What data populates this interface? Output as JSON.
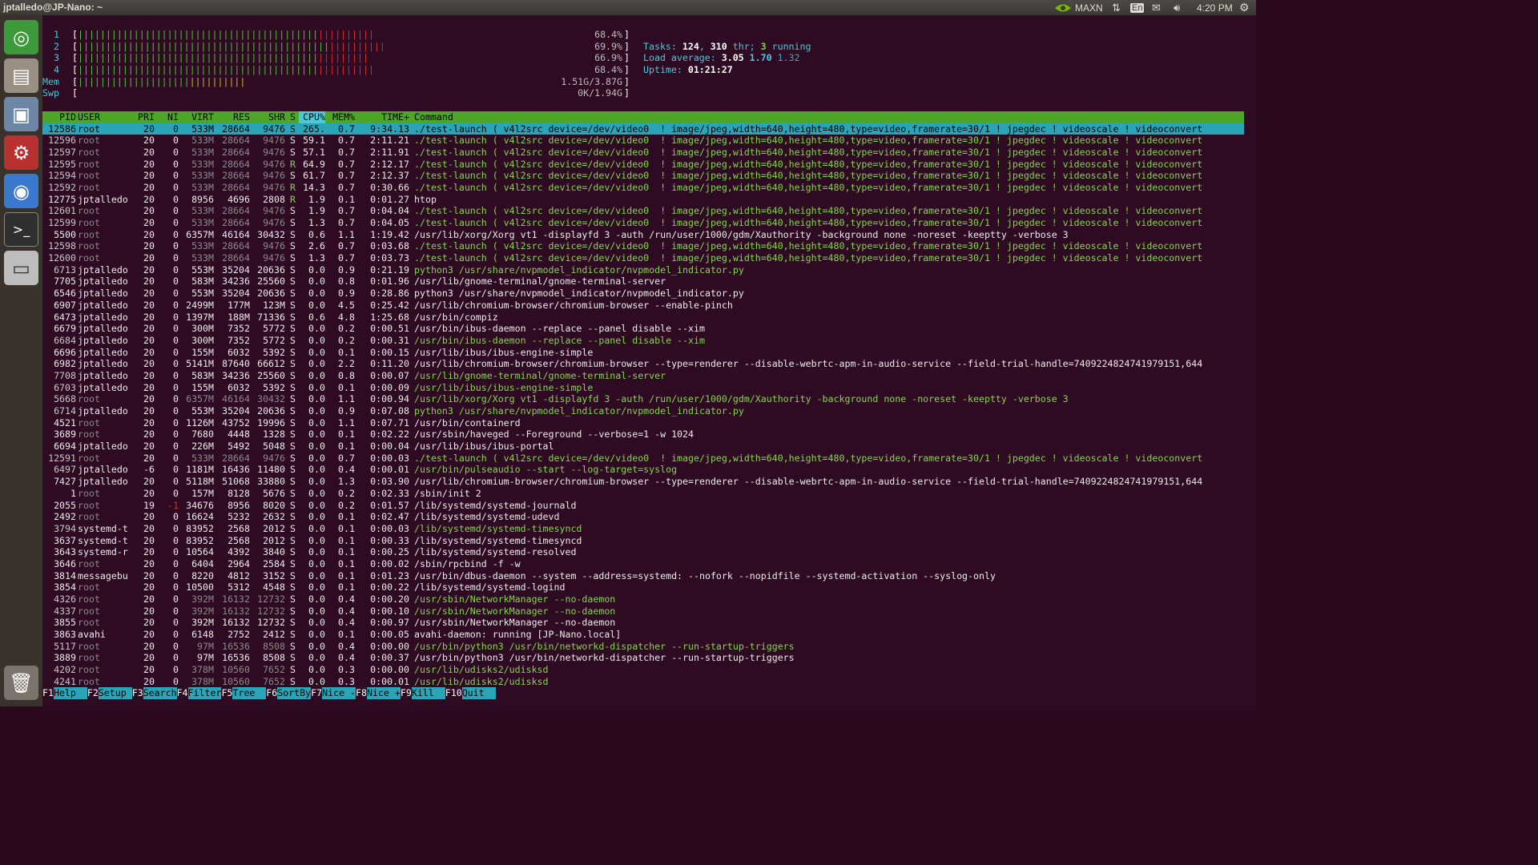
{
  "topbar": {
    "title": "jptalledo@JP-Nano: ~",
    "power_mode": "MAXN",
    "keyboard": "En",
    "clock": "4:20 PM"
  },
  "meters": {
    "cpus": [
      {
        "label": "1",
        "value": "68.4%"
      },
      {
        "label": "2",
        "value": "69.9%"
      },
      {
        "label": "3",
        "value": "66.9%"
      },
      {
        "label": "4",
        "value": "68.4%"
      }
    ],
    "mem": {
      "label": "Mem",
      "value": "1.51G/3.87G"
    },
    "swp": {
      "label": "Swp",
      "value": "0K/1.94G"
    }
  },
  "summary": {
    "tasks_label": "Tasks: ",
    "tasks": "124",
    "thr_sep": ", ",
    "thr": "310",
    "thr_label": " thr; ",
    "running": "3",
    "running_label": " running",
    "load_label": "Load average: ",
    "load1": "3.05",
    "load5": "1.70",
    "load15": "1.32",
    "uptime_label": "Uptime: ",
    "uptime": "01:21:27"
  },
  "header": {
    "pid": "PID",
    "user": "USER",
    "pri": "PRI",
    "ni": "NI",
    "virt": "VIRT",
    "res": "RES",
    "shr": "SHR",
    "s": "S",
    "cpu": "CPU%",
    "mem": "MEM%",
    "time": "TIME+",
    "command": "Command"
  },
  "processes": [
    {
      "pid": "12586",
      "user": "root",
      "pri": "20",
      "ni": "0",
      "virt": "533M",
      "res": "28664",
      "shr": "9476",
      "s": "S",
      "cpu": "265.",
      "mem": "0.7",
      "time": "9:34.13",
      "command": "./test-launch ( v4l2src device=/dev/video0  ! image/jpeg,width=640,height=480,type=video,framerate=30/1 ! jpegdec ! videoscale ! videoconvert",
      "sel": true
    },
    {
      "pid": "12596",
      "user": "root",
      "pri": "20",
      "ni": "0",
      "virt": "533M",
      "res": "28664",
      "shr": "9476",
      "s": "S",
      "cpu": "59.1",
      "mem": "0.7",
      "time": "2:11.21",
      "command": "./test-launch ( v4l2src device=/dev/video0  ! image/jpeg,width=640,height=480,type=video,framerate=30/1 ! jpegdec ! videoscale ! videoconvert",
      "thread": true
    },
    {
      "pid": "12597",
      "user": "root",
      "pri": "20",
      "ni": "0",
      "virt": "533M",
      "res": "28664",
      "shr": "9476",
      "s": "S",
      "cpu": "57.1",
      "mem": "0.7",
      "time": "2:11.91",
      "command": "./test-launch ( v4l2src device=/dev/video0  ! image/jpeg,width=640,height=480,type=video,framerate=30/1 ! jpegdec ! videoscale ! videoconvert",
      "thread": true
    },
    {
      "pid": "12595",
      "user": "root",
      "pri": "20",
      "ni": "0",
      "virt": "533M",
      "res": "28664",
      "shr": "9476",
      "s": "R",
      "cpu": "64.9",
      "mem": "0.7",
      "time": "2:12.17",
      "command": "./test-launch ( v4l2src device=/dev/video0  ! image/jpeg,width=640,height=480,type=video,framerate=30/1 ! jpegdec ! videoscale ! videoconvert",
      "thread": true
    },
    {
      "pid": "12594",
      "user": "root",
      "pri": "20",
      "ni": "0",
      "virt": "533M",
      "res": "28664",
      "shr": "9476",
      "s": "S",
      "cpu": "61.7",
      "mem": "0.7",
      "time": "2:12.37",
      "command": "./test-launch ( v4l2src device=/dev/video0  ! image/jpeg,width=640,height=480,type=video,framerate=30/1 ! jpegdec ! videoscale ! videoconvert",
      "thread": true
    },
    {
      "pid": "12592",
      "user": "root",
      "pri": "20",
      "ni": "0",
      "virt": "533M",
      "res": "28664",
      "shr": "9476",
      "s": "R",
      "cpu": "14.3",
      "mem": "0.7",
      "time": "0:30.66",
      "command": "./test-launch ( v4l2src device=/dev/video0  ! image/jpeg,width=640,height=480,type=video,framerate=30/1 ! jpegdec ! videoscale ! videoconvert",
      "thread": true
    },
    {
      "pid": "12775",
      "user": "jptalledo",
      "pri": "20",
      "ni": "0",
      "virt": "8956",
      "res": "4696",
      "shr": "2808",
      "s": "R",
      "cpu": "1.9",
      "mem": "0.1",
      "time": "0:01.27",
      "command": "htop"
    },
    {
      "pid": "12601",
      "user": "root",
      "pri": "20",
      "ni": "0",
      "virt": "533M",
      "res": "28664",
      "shr": "9476",
      "s": "S",
      "cpu": "1.9",
      "mem": "0.7",
      "time": "0:04.04",
      "command": "./test-launch ( v4l2src device=/dev/video0  ! image/jpeg,width=640,height=480,type=video,framerate=30/1 ! jpegdec ! videoscale ! videoconvert",
      "thread": true
    },
    {
      "pid": "12599",
      "user": "root",
      "pri": "20",
      "ni": "0",
      "virt": "533M",
      "res": "28664",
      "shr": "9476",
      "s": "S",
      "cpu": "1.3",
      "mem": "0.7",
      "time": "0:04.05",
      "command": "./test-launch ( v4l2src device=/dev/video0  ! image/jpeg,width=640,height=480,type=video,framerate=30/1 ! jpegdec ! videoscale ! videoconvert",
      "thread": true
    },
    {
      "pid": "5500",
      "user": "root",
      "pri": "20",
      "ni": "0",
      "virt": "6357M",
      "res": "46164",
      "shr": "30432",
      "s": "S",
      "cpu": "0.6",
      "mem": "1.1",
      "time": "1:19.42",
      "command": "/usr/lib/xorg/Xorg vt1 -displayfd 3 -auth /run/user/1000/gdm/Xauthority -background none -noreset -keeptty -verbose 3"
    },
    {
      "pid": "12598",
      "user": "root",
      "pri": "20",
      "ni": "0",
      "virt": "533M",
      "res": "28664",
      "shr": "9476",
      "s": "S",
      "cpu": "2.6",
      "mem": "0.7",
      "time": "0:03.68",
      "command": "./test-launch ( v4l2src device=/dev/video0  ! image/jpeg,width=640,height=480,type=video,framerate=30/1 ! jpegdec ! videoscale ! videoconvert",
      "thread": true
    },
    {
      "pid": "12600",
      "user": "root",
      "pri": "20",
      "ni": "0",
      "virt": "533M",
      "res": "28664",
      "shr": "9476",
      "s": "S",
      "cpu": "1.3",
      "mem": "0.7",
      "time": "0:03.73",
      "command": "./test-launch ( v4l2src device=/dev/video0  ! image/jpeg,width=640,height=480,type=video,framerate=30/1 ! jpegdec ! videoscale ! videoconvert",
      "thread": true
    },
    {
      "pid": "6713",
      "user": "jptalledo",
      "pri": "20",
      "ni": "0",
      "virt": "553M",
      "res": "35204",
      "shr": "20636",
      "s": "S",
      "cpu": "0.0",
      "mem": "0.9",
      "time": "0:21.19",
      "command": "python3 /usr/share/nvpmodel_indicator/nvpmodel_indicator.py",
      "thread": true
    },
    {
      "pid": "7705",
      "user": "jptalledo",
      "pri": "20",
      "ni": "0",
      "virt": "583M",
      "res": "34236",
      "shr": "25560",
      "s": "S",
      "cpu": "0.0",
      "mem": "0.8",
      "time": "0:01.96",
      "command": "/usr/lib/gnome-terminal/gnome-terminal-server"
    },
    {
      "pid": "6546",
      "user": "jptalledo",
      "pri": "20",
      "ni": "0",
      "virt": "553M",
      "res": "35204",
      "shr": "20636",
      "s": "S",
      "cpu": "0.0",
      "mem": "0.9",
      "time": "0:28.86",
      "command": "python3 /usr/share/nvpmodel_indicator/nvpmodel_indicator.py"
    },
    {
      "pid": "6907",
      "user": "jptalledo",
      "pri": "20",
      "ni": "0",
      "virt": "2499M",
      "res": "177M",
      "shr": "123M",
      "s": "S",
      "cpu": "0.0",
      "mem": "4.5",
      "time": "0:25.42",
      "command": "/usr/lib/chromium-browser/chromium-browser --enable-pinch"
    },
    {
      "pid": "6473",
      "user": "jptalledo",
      "pri": "20",
      "ni": "0",
      "virt": "1397M",
      "res": "188M",
      "shr": "71336",
      "s": "S",
      "cpu": "0.6",
      "mem": "4.8",
      "time": "1:25.68",
      "command": "/usr/bin/compiz"
    },
    {
      "pid": "6679",
      "user": "jptalledo",
      "pri": "20",
      "ni": "0",
      "virt": "300M",
      "res": "7352",
      "shr": "5772",
      "s": "S",
      "cpu": "0.0",
      "mem": "0.2",
      "time": "0:00.51",
      "command": "/usr/bin/ibus-daemon --replace --panel disable --xim"
    },
    {
      "pid": "6684",
      "user": "jptalledo",
      "pri": "20",
      "ni": "0",
      "virt": "300M",
      "res": "7352",
      "shr": "5772",
      "s": "S",
      "cpu": "0.0",
      "mem": "0.2",
      "time": "0:00.31",
      "command": "/usr/bin/ibus-daemon --replace --panel disable --xim",
      "thread": true
    },
    {
      "pid": "6696",
      "user": "jptalledo",
      "pri": "20",
      "ni": "0",
      "virt": "155M",
      "res": "6032",
      "shr": "5392",
      "s": "S",
      "cpu": "0.0",
      "mem": "0.1",
      "time": "0:00.15",
      "command": "/usr/lib/ibus/ibus-engine-simple"
    },
    {
      "pid": "6982",
      "user": "jptalledo",
      "pri": "20",
      "ni": "0",
      "virt": "5141M",
      "res": "87640",
      "shr": "66612",
      "s": "S",
      "cpu": "0.0",
      "mem": "2.2",
      "time": "0:11.20",
      "command": "/usr/lib/chromium-browser/chromium-browser --type=renderer --disable-webrtc-apm-in-audio-service --field-trial-handle=7409224824741979151,644"
    },
    {
      "pid": "7708",
      "user": "jptalledo",
      "pri": "20",
      "ni": "0",
      "virt": "583M",
      "res": "34236",
      "shr": "25560",
      "s": "S",
      "cpu": "0.0",
      "mem": "0.8",
      "time": "0:00.07",
      "command": "/usr/lib/gnome-terminal/gnome-terminal-server",
      "thread": true
    },
    {
      "pid": "6703",
      "user": "jptalledo",
      "pri": "20",
      "ni": "0",
      "virt": "155M",
      "res": "6032",
      "shr": "5392",
      "s": "S",
      "cpu": "0.0",
      "mem": "0.1",
      "time": "0:00.09",
      "command": "/usr/lib/ibus/ibus-engine-simple",
      "thread": true
    },
    {
      "pid": "5668",
      "user": "root",
      "pri": "20",
      "ni": "0",
      "virt": "6357M",
      "res": "46164",
      "shr": "30432",
      "s": "S",
      "cpu": "0.0",
      "mem": "1.1",
      "time": "0:00.94",
      "command": "/usr/lib/xorg/Xorg vt1 -displayfd 3 -auth /run/user/1000/gdm/Xauthority -background none -noreset -keeptty -verbose 3",
      "thread": true
    },
    {
      "pid": "6714",
      "user": "jptalledo",
      "pri": "20",
      "ni": "0",
      "virt": "553M",
      "res": "35204",
      "shr": "20636",
      "s": "S",
      "cpu": "0.0",
      "mem": "0.9",
      "time": "0:07.08",
      "command": "python3 /usr/share/nvpmodel_indicator/nvpmodel_indicator.py",
      "thread": true
    },
    {
      "pid": "4521",
      "user": "root",
      "pri": "20",
      "ni": "0",
      "virt": "1126M",
      "res": "43752",
      "shr": "19996",
      "s": "S",
      "cpu": "0.0",
      "mem": "1.1",
      "time": "0:07.71",
      "command": "/usr/bin/containerd"
    },
    {
      "pid": "3689",
      "user": "root",
      "pri": "20",
      "ni": "0",
      "virt": "7680",
      "res": "4448",
      "shr": "1328",
      "s": "S",
      "cpu": "0.0",
      "mem": "0.1",
      "time": "0:02.22",
      "command": "/usr/sbin/haveged --Foreground --verbose=1 -w 1024"
    },
    {
      "pid": "6694",
      "user": "jptalledo",
      "pri": "20",
      "ni": "0",
      "virt": "226M",
      "res": "5492",
      "shr": "5048",
      "s": "S",
      "cpu": "0.0",
      "mem": "0.1",
      "time": "0:00.04",
      "command": "/usr/lib/ibus/ibus-portal"
    },
    {
      "pid": "12591",
      "user": "root",
      "pri": "20",
      "ni": "0",
      "virt": "533M",
      "res": "28664",
      "shr": "9476",
      "s": "S",
      "cpu": "0.0",
      "mem": "0.7",
      "time": "0:00.03",
      "command": "./test-launch ( v4l2src device=/dev/video0  ! image/jpeg,width=640,height=480,type=video,framerate=30/1 ! jpegdec ! videoscale ! videoconvert",
      "thread": true
    },
    {
      "pid": "6497",
      "user": "jptalledo",
      "pri": "-6",
      "ni": "0",
      "virt": "1181M",
      "res": "16436",
      "shr": "11480",
      "s": "S",
      "cpu": "0.0",
      "mem": "0.4",
      "time": "0:00.01",
      "command": "/usr/bin/pulseaudio --start --log-target=syslog",
      "thread": true
    },
    {
      "pid": "7427",
      "user": "jptalledo",
      "pri": "20",
      "ni": "0",
      "virt": "5118M",
      "res": "51068",
      "shr": "33880",
      "s": "S",
      "cpu": "0.0",
      "mem": "1.3",
      "time": "0:03.90",
      "command": "/usr/lib/chromium-browser/chromium-browser --type=renderer --disable-webrtc-apm-in-audio-service --field-trial-handle=7409224824741979151,644"
    },
    {
      "pid": "1",
      "user": "root",
      "pri": "20",
      "ni": "0",
      "virt": "157M",
      "res": "8128",
      "shr": "5676",
      "s": "S",
      "cpu": "0.0",
      "mem": "0.2",
      "time": "0:02.33",
      "command": "/sbin/init 2"
    },
    {
      "pid": "2055",
      "user": "root",
      "pri": "19",
      "ni": "-1",
      "virt": "34676",
      "res": "8956",
      "shr": "8020",
      "s": "S",
      "cpu": "0.0",
      "mem": "0.2",
      "time": "0:01.57",
      "command": "/lib/systemd/systemd-journald"
    },
    {
      "pid": "2492",
      "user": "root",
      "pri": "20",
      "ni": "0",
      "virt": "16624",
      "res": "5232",
      "shr": "2632",
      "s": "S",
      "cpu": "0.0",
      "mem": "0.1",
      "time": "0:02.47",
      "command": "/lib/systemd/systemd-udevd"
    },
    {
      "pid": "3794",
      "user": "systemd-t",
      "pri": "20",
      "ni": "0",
      "virt": "83952",
      "res": "2568",
      "shr": "2012",
      "s": "S",
      "cpu": "0.0",
      "mem": "0.1",
      "time": "0:00.03",
      "command": "/lib/systemd/systemd-timesyncd",
      "thread": true
    },
    {
      "pid": "3637",
      "user": "systemd-t",
      "pri": "20",
      "ni": "0",
      "virt": "83952",
      "res": "2568",
      "shr": "2012",
      "s": "S",
      "cpu": "0.0",
      "mem": "0.1",
      "time": "0:00.33",
      "command": "/lib/systemd/systemd-timesyncd"
    },
    {
      "pid": "3643",
      "user": "systemd-r",
      "pri": "20",
      "ni": "0",
      "virt": "10564",
      "res": "4392",
      "shr": "3840",
      "s": "S",
      "cpu": "0.0",
      "mem": "0.1",
      "time": "0:00.25",
      "command": "/lib/systemd/systemd-resolved"
    },
    {
      "pid": "3646",
      "user": "root",
      "pri": "20",
      "ni": "0",
      "virt": "6404",
      "res": "2964",
      "shr": "2584",
      "s": "S",
      "cpu": "0.0",
      "mem": "0.1",
      "time": "0:00.02",
      "command": "/sbin/rpcbind -f -w"
    },
    {
      "pid": "3814",
      "user": "messagebu",
      "pri": "20",
      "ni": "0",
      "virt": "8220",
      "res": "4812",
      "shr": "3152",
      "s": "S",
      "cpu": "0.0",
      "mem": "0.1",
      "time": "0:01.23",
      "command": "/usr/bin/dbus-daemon --system --address=systemd: --nofork --nopidfile --systemd-activation --syslog-only"
    },
    {
      "pid": "3854",
      "user": "root",
      "pri": "20",
      "ni": "0",
      "virt": "10500",
      "res": "5312",
      "shr": "4548",
      "s": "S",
      "cpu": "0.0",
      "mem": "0.1",
      "time": "0:00.22",
      "command": "/lib/systemd/systemd-logind"
    },
    {
      "pid": "4326",
      "user": "root",
      "pri": "20",
      "ni": "0",
      "virt": "392M",
      "res": "16132",
      "shr": "12732",
      "s": "S",
      "cpu": "0.0",
      "mem": "0.4",
      "time": "0:00.20",
      "command": "/usr/sbin/NetworkManager --no-daemon",
      "thread": true
    },
    {
      "pid": "4337",
      "user": "root",
      "pri": "20",
      "ni": "0",
      "virt": "392M",
      "res": "16132",
      "shr": "12732",
      "s": "S",
      "cpu": "0.0",
      "mem": "0.4",
      "time": "0:00.10",
      "command": "/usr/sbin/NetworkManager --no-daemon",
      "thread": true
    },
    {
      "pid": "3855",
      "user": "root",
      "pri": "20",
      "ni": "0",
      "virt": "392M",
      "res": "16132",
      "shr": "12732",
      "s": "S",
      "cpu": "0.0",
      "mem": "0.4",
      "time": "0:00.97",
      "command": "/usr/sbin/NetworkManager --no-daemon"
    },
    {
      "pid": "3863",
      "user": "avahi",
      "pri": "20",
      "ni": "0",
      "virt": "6148",
      "res": "2752",
      "shr": "2412",
      "s": "S",
      "cpu": "0.0",
      "mem": "0.1",
      "time": "0:00.05",
      "command": "avahi-daemon: running [JP-Nano.local]"
    },
    {
      "pid": "5117",
      "user": "root",
      "pri": "20",
      "ni": "0",
      "virt": "97M",
      "res": "16536",
      "shr": "8508",
      "s": "S",
      "cpu": "0.0",
      "mem": "0.4",
      "time": "0:00.00",
      "command": "/usr/bin/python3 /usr/bin/networkd-dispatcher --run-startup-triggers",
      "thread": true
    },
    {
      "pid": "3889",
      "user": "root",
      "pri": "20",
      "ni": "0",
      "virt": "97M",
      "res": "16536",
      "shr": "8508",
      "s": "S",
      "cpu": "0.0",
      "mem": "0.4",
      "time": "0:00.37",
      "command": "/usr/bin/python3 /usr/bin/networkd-dispatcher --run-startup-triggers"
    },
    {
      "pid": "4202",
      "user": "root",
      "pri": "20",
      "ni": "0",
      "virt": "378M",
      "res": "10560",
      "shr": "7652",
      "s": "S",
      "cpu": "0.0",
      "mem": "0.3",
      "time": "0:00.00",
      "command": "/usr/lib/udisks2/udisksd",
      "thread": true
    },
    {
      "pid": "4241",
      "user": "root",
      "pri": "20",
      "ni": "0",
      "virt": "378M",
      "res": "10560",
      "shr": "7652",
      "s": "S",
      "cpu": "0.0",
      "mem": "0.3",
      "time": "0:00.01",
      "command": "/usr/lib/udisks2/udisksd",
      "thread": true
    }
  ],
  "function_keys": [
    {
      "key": "F1",
      "label": "Help  "
    },
    {
      "key": "F2",
      "label": "Setup "
    },
    {
      "key": "F3",
      "label": "Search"
    },
    {
      "key": "F4",
      "label": "Filter"
    },
    {
      "key": "F5",
      "label": "Tree  "
    },
    {
      "key": "F6",
      "label": "SortBy"
    },
    {
      "key": "F7",
      "label": "Nice -"
    },
    {
      "key": "F8",
      "label": "Nice +"
    },
    {
      "key": "F9",
      "label": "Kill  "
    },
    {
      "key": "F10",
      "label": "Quit  "
    }
  ],
  "colors": {
    "bg": "#2e0b22",
    "header": "#4ea628",
    "selected": "#2aa5b8",
    "thread": "#86d44f",
    "cyan": "#4cc9d8",
    "bar_green": "#51c13b",
    "bar_red": "#d22d2d",
    "bar_yellow": "#d6b42e"
  }
}
